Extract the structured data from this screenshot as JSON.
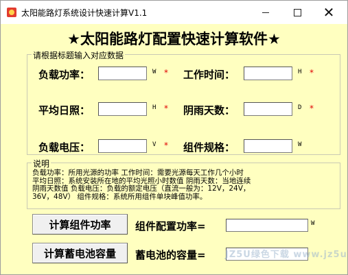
{
  "window": {
    "title": "太阳能路灯系统设计快速计算V1.1",
    "controls": {
      "minimize": "",
      "maximize": "",
      "close": "✕"
    }
  },
  "heading": "★太阳能路灯配置快速计算软件★",
  "input_group": {
    "legend": "请根据标题输入对应数据",
    "fields": [
      {
        "label": "负载功率：",
        "value": "",
        "unit": "W",
        "required": "*"
      },
      {
        "label": "工作时间：",
        "value": "",
        "unit": "H",
        "required": "*"
      },
      {
        "label": "平均日照：",
        "value": "",
        "unit": "H",
        "required": "*"
      },
      {
        "label": "阴雨天数：",
        "value": "",
        "unit": "D",
        "required": "*"
      },
      {
        "label": "负载电压：",
        "value": "",
        "unit": "V",
        "required": "*"
      },
      {
        "label": "组件规格：",
        "value": "",
        "unit": "W",
        "required": ""
      }
    ]
  },
  "note_group": {
    "legend": "说明",
    "lines": [
      "负载功率：所用光源的功率     工作时间：需要光源每天工作几个小时",
      "平均日照：系统安装所在地的平均光照小时数值  阴雨天数：当地连续",
      "阴雨天数值  负载电压：负载的额定电压（直流一般为：12V，24V，",
      "36V，48V）  组件规格：系统所用组件单块峰值功率。"
    ]
  },
  "actions": {
    "panel_button": "计算组件功率",
    "panel_result_label": "组件配置功率=",
    "panel_result_value": "",
    "panel_unit": "W",
    "battery_button": "计算蓄电池容量",
    "battery_result_label": "蓄电池的容量=",
    "battery_result_value": ""
  },
  "watermark": "JZ5U绿色下载 www.jz5u.com"
}
